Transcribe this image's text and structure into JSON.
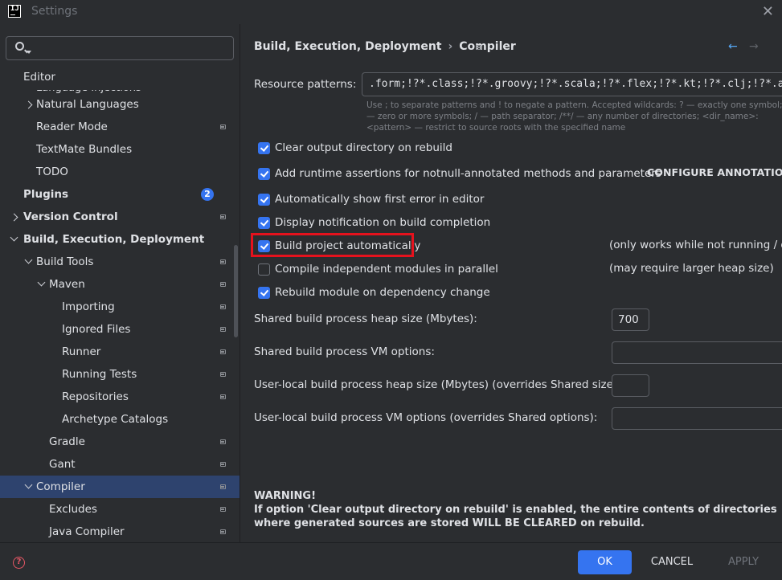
{
  "window": {
    "title": "Settings",
    "logo_text": "IJ"
  },
  "search": {
    "placeholder": ""
  },
  "sidebar": {
    "partial_item": "Language Injections",
    "header": "Editor",
    "items": [
      {
        "label": "Natural Languages"
      },
      {
        "label": "Reader Mode"
      },
      {
        "label": "TextMate Bundles"
      },
      {
        "label": "TODO"
      },
      {
        "label": "Plugins",
        "badge": "2"
      },
      {
        "label": "Version Control"
      },
      {
        "label": "Build, Execution, Deployment"
      },
      {
        "label": "Build Tools"
      },
      {
        "label": "Maven"
      },
      {
        "label": "Importing"
      },
      {
        "label": "Ignored Files"
      },
      {
        "label": "Runner"
      },
      {
        "label": "Running Tests"
      },
      {
        "label": "Repositories"
      },
      {
        "label": "Archetype Catalogs"
      },
      {
        "label": "Gradle"
      },
      {
        "label": "Gant"
      },
      {
        "label": "Compiler"
      },
      {
        "label": "Excludes"
      },
      {
        "label": "Java Compiler"
      }
    ]
  },
  "breadcrumb": {
    "parent": "Build, Execution, Deployment",
    "separator": "›",
    "current": "Compiler"
  },
  "nav": {
    "back": "←",
    "forward": "→"
  },
  "resource": {
    "label": "Resource patterns:",
    "value": ".form;!?*.class;!?*.groovy;!?*.scala;!?*.flex;!?*.kt;!?*.clj;!?*.aj",
    "hint": "Use ; to separate patterns and ! to negate a pattern. Accepted wildcards: ? — exactly one symbol; * — zero or more symbols; / — path separator; /**/ — any number of directories; <dir_name>:<pattern> — restrict to source roots with the specified name"
  },
  "checkboxes": [
    {
      "label": "Clear output directory on rebuild",
      "checked": true
    },
    {
      "label": "Add runtime assertions for notnull-annotated methods and parameters",
      "checked": true
    },
    {
      "label": "Automatically show first error in editor",
      "checked": true
    },
    {
      "label": "Display notification on build completion",
      "checked": true
    },
    {
      "label": "Build project automatically",
      "checked": true
    },
    {
      "label": "Compile independent modules in parallel",
      "checked": false
    },
    {
      "label": "Rebuild module on dependency change",
      "checked": true
    }
  ],
  "configure_annotations": "CONFIGURE ANNOTATIONS...",
  "notes": {
    "auto_build": "(only works while not running / debugging)",
    "parallel": "(may require larger heap size)"
  },
  "fields": {
    "shared_heap_label": "Shared build process heap size (Mbytes):",
    "shared_heap_value": "700",
    "shared_vm_label": "Shared build process VM options:",
    "shared_vm_value": "",
    "user_heap_label": "User-local build process heap size (Mbytes) (overrides Shared size):",
    "user_heap_value": "",
    "user_vm_label": "User-local build process VM options (overrides Shared options):",
    "user_vm_value": ""
  },
  "warning": {
    "title": "WARNING!",
    "text": "If option 'Clear output directory on rebuild' is enabled, the entire contents of directories where generated sources are stored WILL BE CLEARED on rebuild."
  },
  "footer": {
    "help": "?",
    "ok": "OK",
    "cancel": "CANCEL",
    "apply": "APPLY"
  }
}
